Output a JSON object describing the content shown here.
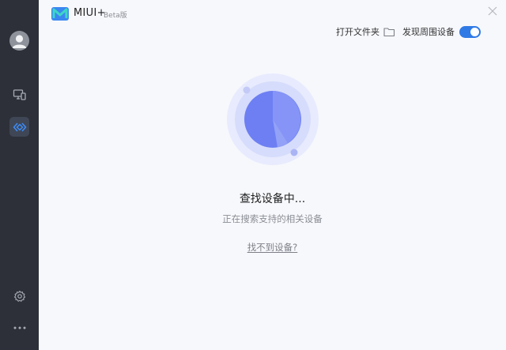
{
  "app": {
    "name": "MIUI+",
    "badge": "Beta版",
    "logo": "miui-logo"
  },
  "sidebar": {
    "avatar_icon": "user-avatar-icon",
    "items": [
      {
        "id": "devices",
        "icon": "monitor-phone-icon",
        "active": false
      },
      {
        "id": "connect",
        "icon": "connect-diamond-icon",
        "active": true
      }
    ],
    "settings_icon": "gear-icon",
    "more_icon": "more-dots-icon"
  },
  "toolbar": {
    "open_folder_label": "打开文件夹",
    "discover_label": "发现周围设备",
    "discover_enabled": true
  },
  "search": {
    "title": "查找设备中...",
    "subtitle": "正在搜索支持的相关设备",
    "help_link": "找不到设备?"
  },
  "colors": {
    "sidebar_bg": "#2d3038",
    "main_bg": "#f7f8fc",
    "accent": "#2f7ae5",
    "radar_core": "#6d7ff3"
  }
}
